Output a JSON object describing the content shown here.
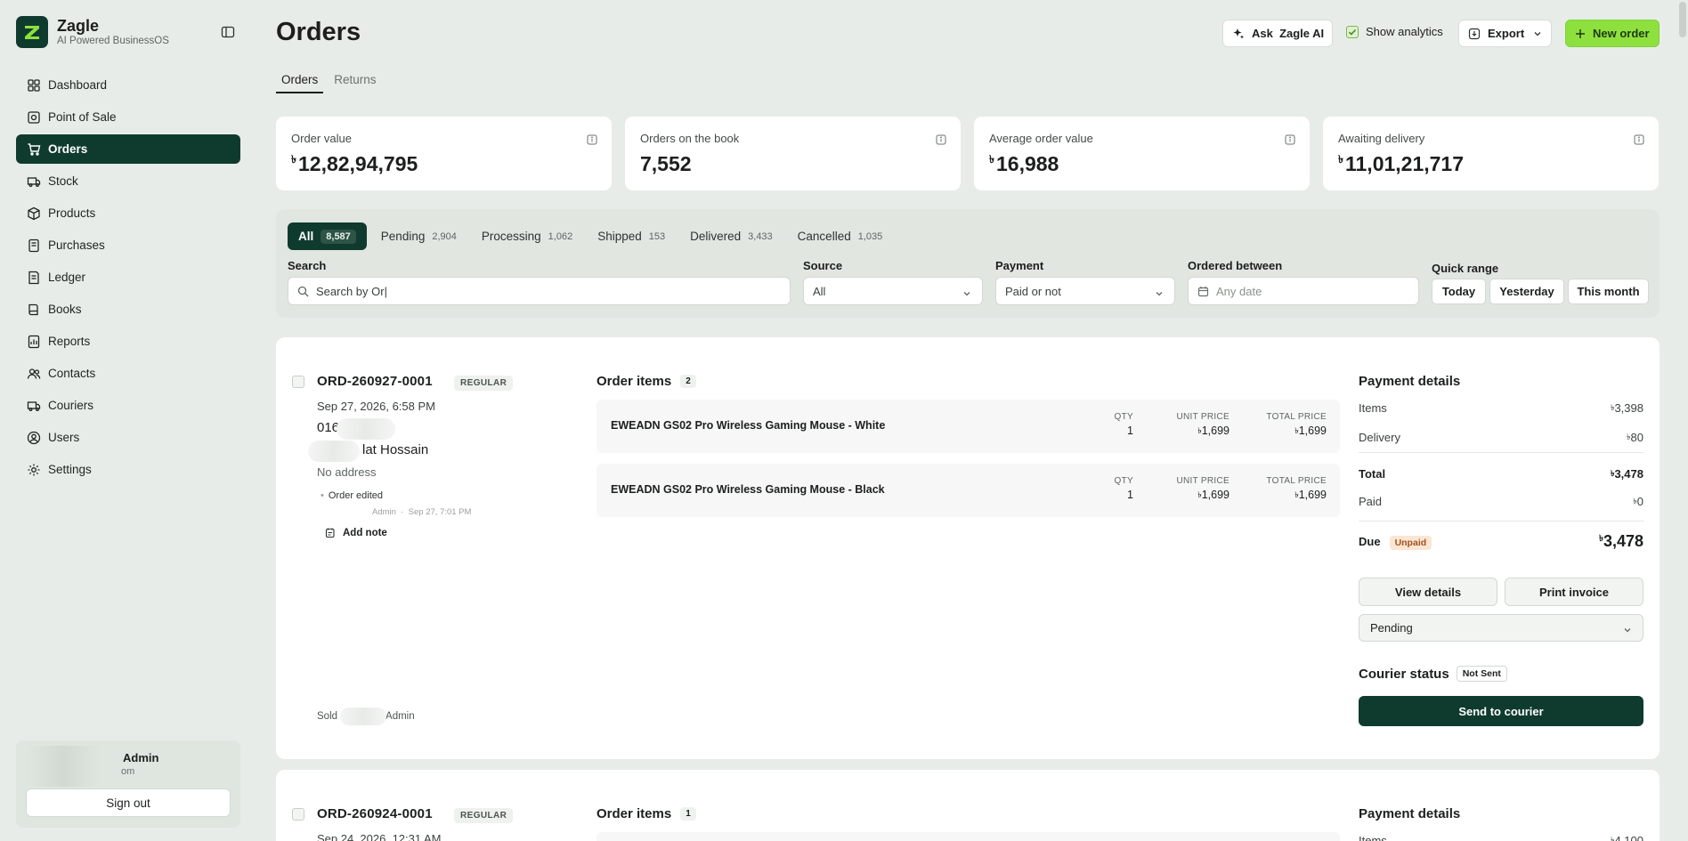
{
  "brand": {
    "name": "Zagle",
    "tagline": "AI Powered BusinessOS"
  },
  "sidebar": {
    "items": [
      {
        "label": "Dashboard",
        "icon": "dashboard-icon"
      },
      {
        "label": "Point of Sale",
        "icon": "pos-icon"
      },
      {
        "label": "Orders",
        "icon": "cart-icon",
        "active": true
      },
      {
        "label": "Stock",
        "icon": "truck-icon"
      },
      {
        "label": "Products",
        "icon": "box-icon"
      },
      {
        "label": "Purchases",
        "icon": "receipt-icon"
      },
      {
        "label": "Ledger",
        "icon": "ledger-icon"
      },
      {
        "label": "Books",
        "icon": "book-icon"
      },
      {
        "label": "Reports",
        "icon": "report-icon"
      },
      {
        "label": "Contacts",
        "icon": "contacts-icon"
      },
      {
        "label": "Couriers",
        "icon": "courier-icon"
      },
      {
        "label": "Users",
        "icon": "user-icon"
      },
      {
        "label": "Settings",
        "icon": "gear-icon"
      }
    ],
    "user": {
      "name": "Admin",
      "email_fragment": "om",
      "signout_label": "Sign out"
    }
  },
  "header": {
    "title": "Orders",
    "ask_label": "Ask  Zagle AI",
    "analytics_label": "Show analytics",
    "export_label": "Export",
    "new_label": "New order",
    "tabs": [
      "Orders",
      "Returns"
    ]
  },
  "currency_symbol": "৳",
  "metrics": [
    {
      "label": "Order value",
      "value": "12,82,94,795",
      "currency": true
    },
    {
      "label": "Orders on the book",
      "value": "7,552",
      "currency": false
    },
    {
      "label": "Average order value",
      "value": "16,988",
      "currency": true
    },
    {
      "label": "Awaiting delivery",
      "value": "11,01,21,717",
      "currency": true
    }
  ],
  "filters": {
    "status_tabs": [
      {
        "label": "All",
        "count": "8,587"
      },
      {
        "label": "Pending",
        "count": "2,904"
      },
      {
        "label": "Processing",
        "count": "1,062"
      },
      {
        "label": "Shipped",
        "count": "153"
      },
      {
        "label": "Delivered",
        "count": "3,433"
      },
      {
        "label": "Cancelled",
        "count": "1,035"
      }
    ],
    "search": {
      "label": "Search",
      "value": "Search by Or|"
    },
    "source": {
      "label": "Source",
      "value": "All"
    },
    "payment": {
      "label": "Payment",
      "value": "Paid or not"
    },
    "ordered_between": {
      "label": "Ordered between",
      "placeholder": "Any date"
    },
    "quick_range": {
      "label": "Quick range",
      "options": [
        "Today",
        "Yesterday",
        "This month"
      ]
    }
  },
  "orders": [
    {
      "id": "ORD-260927-0001",
      "type": "REGULAR",
      "date": "Sep 27, 2026, 6:58 PM",
      "phone": "016",
      "name": "lat Hossain",
      "address": "No address",
      "history_event": "Order edited",
      "history_meta": "Admin  ·  Sep 27, 7:01 PM",
      "add_note_label": "Add note",
      "sold_by": "Sold",
      "sold_by_user": "Admin",
      "items_title": "Order items",
      "items_count": "2",
      "items": [
        {
          "name": "EWEADN GS02 Pro Wireless Gaming Mouse - White",
          "qty": "1",
          "unit_price": "1,699",
          "total_price": "1,699"
        },
        {
          "name": "EWEADN GS02 Pro Wireless Gaming Mouse - Black",
          "qty": "1",
          "unit_price": "1,699",
          "total_price": "1,699"
        }
      ],
      "col_headers": {
        "qty": "QTY",
        "unit": "UNIT PRICE",
        "total": "TOTAL PRICE"
      },
      "payment": {
        "title": "Payment details",
        "items_label": "Items",
        "items_value": "3,398",
        "delivery_label": "Delivery",
        "delivery_value": "80",
        "total_label": "Total",
        "total_value": "3,478",
        "paid_label": "Paid",
        "paid_value": "0",
        "due_label": "Due",
        "due_value": "3,478",
        "due_badge": "Unpaid",
        "view_label": "View details",
        "print_label": "Print invoice",
        "status_value": "Pending",
        "courier_label": "Courier status",
        "courier_badge": "Not Sent",
        "send_label": "Send to courier"
      }
    },
    {
      "id": "ORD-260924-0001",
      "type": "REGULAR",
      "date": "Sep 24, 2026, 12:31 AM",
      "items_title": "Order items",
      "items_count": "1",
      "payment_title": "Payment details",
      "items_label": "Items",
      "items_value": "4,100"
    }
  ],
  "colors": {
    "primary": "#0f3b2e",
    "accent": "#8ee03f",
    "background": "#e8ece8"
  }
}
